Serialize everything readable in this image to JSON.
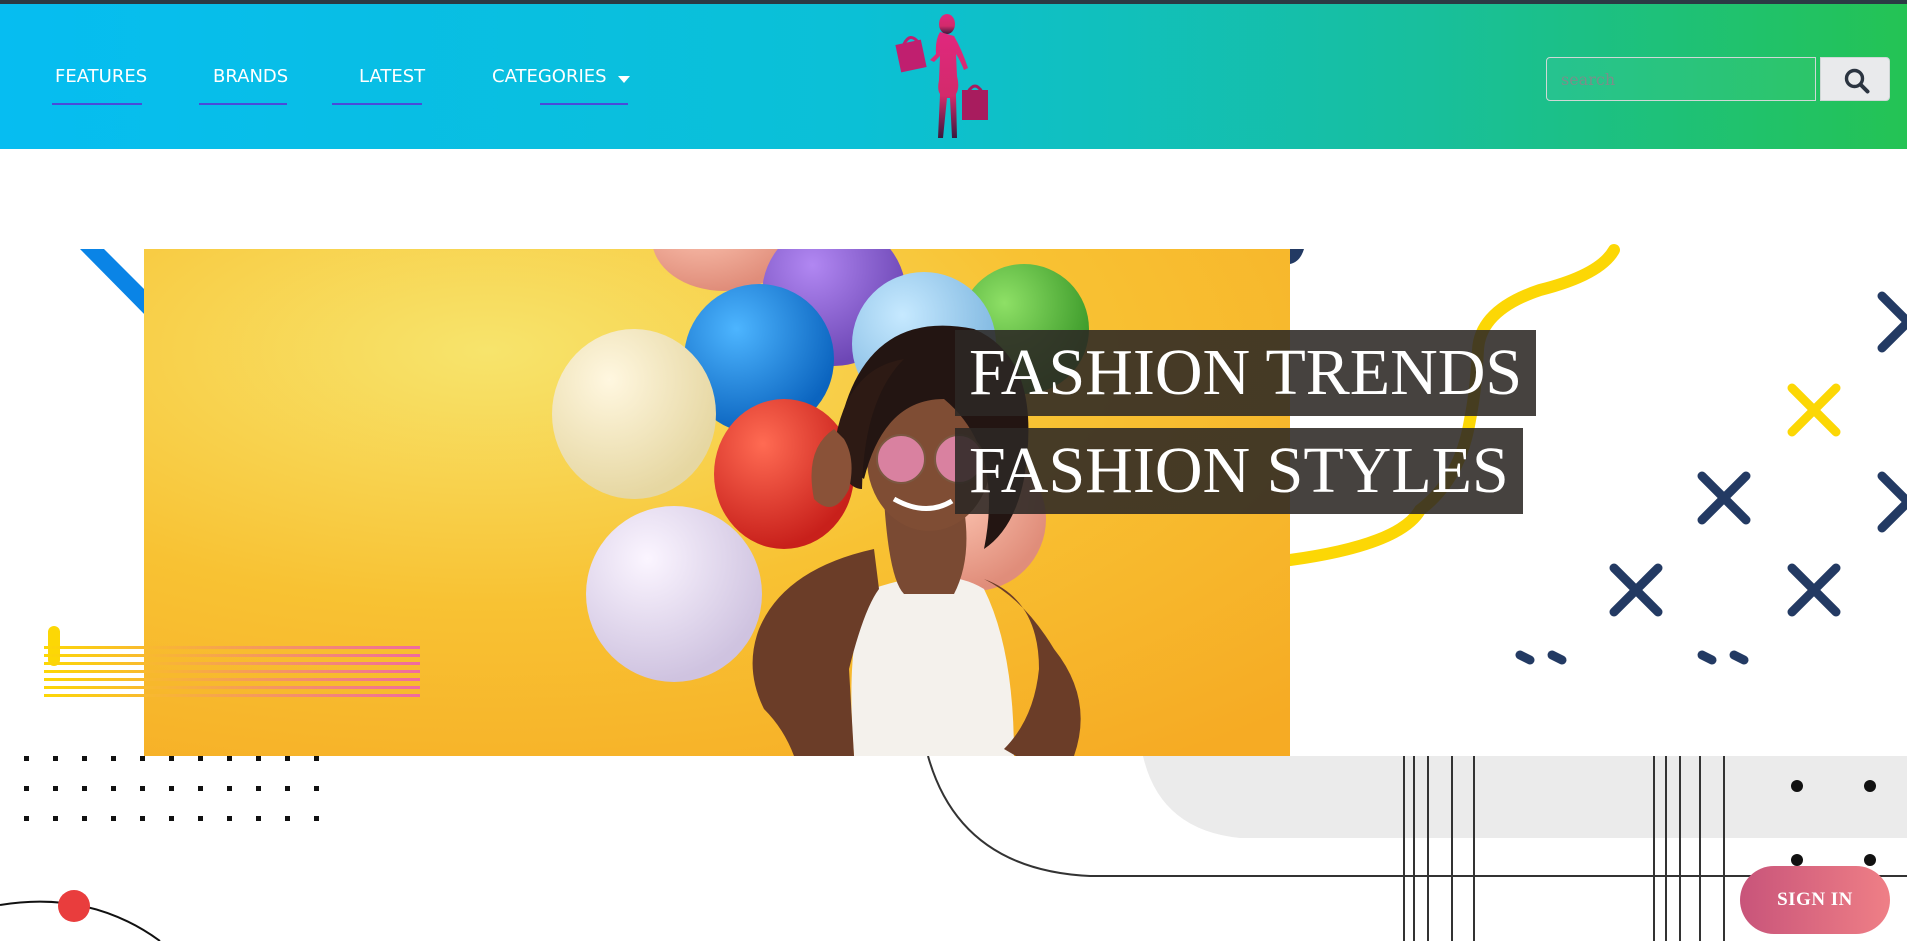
{
  "nav": {
    "items": [
      {
        "label": "FEATURES"
      },
      {
        "label": "BRANDS"
      },
      {
        "label": "LATEST"
      },
      {
        "label": "CATEGORIES"
      }
    ]
  },
  "logo": {
    "icon": "shopping-woman-silhouette-icon"
  },
  "search": {
    "placeholder": "search",
    "icon": "search-icon"
  },
  "hero": {
    "caption_line1": "FASHION TRENDS",
    "caption_line2": "FASHION STYLES"
  },
  "signin": {
    "label": "SIGN IN"
  },
  "colors": {
    "nav_gradient_start": "#06bdf1",
    "nav_gradient_end": "#24c354",
    "hero_yellow": "#f7b930",
    "decor_navy": "#233a63",
    "decor_yellow": "#fcd705",
    "decor_blue": "#0a84e6",
    "signin_gradient_start": "#c8547a",
    "signin_gradient_end": "#ef7f86"
  }
}
